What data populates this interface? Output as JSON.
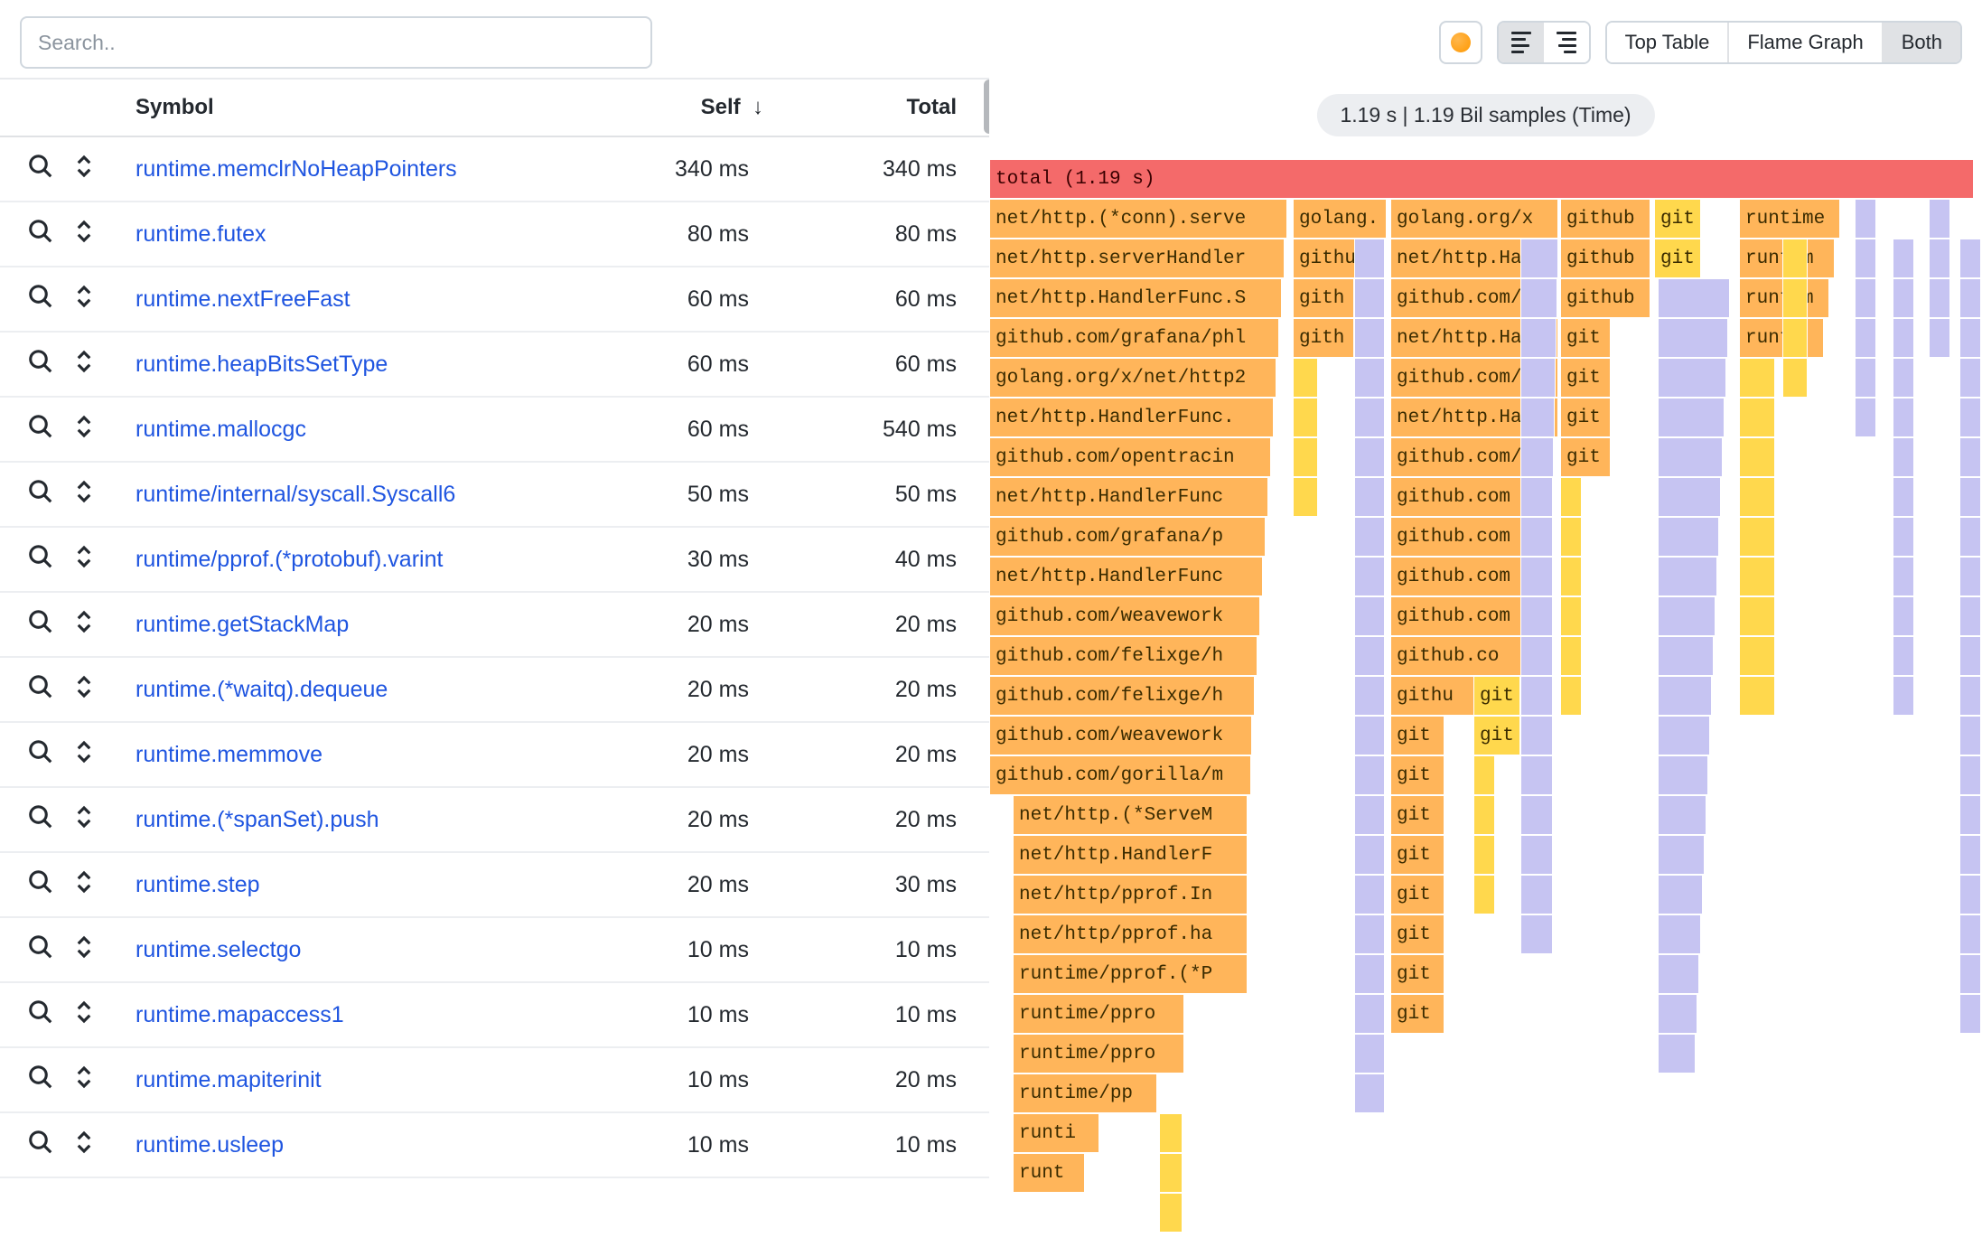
{
  "toolbar": {
    "search_placeholder": "Search..",
    "tabs": {
      "top_table": "Top Table",
      "flame_graph": "Flame Graph",
      "both": "Both"
    }
  },
  "summary_pill": "1.19 s | 1.19 Bil samples (Time)",
  "table": {
    "headers": {
      "symbol": "Symbol",
      "self": "Self",
      "self_sort": "↓",
      "total": "Total"
    },
    "rows": [
      {
        "symbol": "runtime.memclrNoHeapPointers",
        "self": "340 ms",
        "total": "340 ms"
      },
      {
        "symbol": "runtime.futex",
        "self": "80 ms",
        "total": "80 ms"
      },
      {
        "symbol": "runtime.nextFreeFast",
        "self": "60 ms",
        "total": "60 ms"
      },
      {
        "symbol": "runtime.heapBitsSetType",
        "self": "60 ms",
        "total": "60 ms"
      },
      {
        "symbol": "runtime.mallocgc",
        "self": "60 ms",
        "total": "540 ms"
      },
      {
        "symbol": "runtime/internal/syscall.Syscall6",
        "self": "50 ms",
        "total": "50 ms"
      },
      {
        "symbol": "runtime/pprof.(*protobuf).varint",
        "self": "30 ms",
        "total": "40 ms"
      },
      {
        "symbol": "runtime.getStackMap",
        "self": "20 ms",
        "total": "20 ms"
      },
      {
        "symbol": "runtime.(*waitq).dequeue",
        "self": "20 ms",
        "total": "20 ms"
      },
      {
        "symbol": "runtime.memmove",
        "self": "20 ms",
        "total": "20 ms"
      },
      {
        "symbol": "runtime.(*spanSet).push",
        "self": "20 ms",
        "total": "20 ms"
      },
      {
        "symbol": "runtime.step",
        "self": "20 ms",
        "total": "30 ms"
      },
      {
        "symbol": "runtime.selectgo",
        "self": "10 ms",
        "total": "10 ms"
      },
      {
        "symbol": "runtime.mapaccess1",
        "self": "10 ms",
        "total": "10 ms"
      },
      {
        "symbol": "runtime.mapiterinit",
        "self": "10 ms",
        "total": "20 ms"
      },
      {
        "symbol": "runtime.usleep",
        "self": "10 ms",
        "total": "10 ms"
      }
    ]
  },
  "flame": {
    "total_label": "total (1.19 s)",
    "col0": [
      "net/http.(*conn).serve",
      "net/http.serverHandler",
      "net/http.HandlerFunc.S",
      "github.com/grafana/phl",
      "golang.org/x/net/http2",
      "net/http.HandlerFunc.",
      "github.com/opentracin",
      "net/http.HandlerFunc",
      "github.com/grafana/p",
      "net/http.HandlerFunc",
      "github.com/weavework",
      "github.com/felixge/h",
      "github.com/felixge/h",
      "github.com/weavework",
      "github.com/gorilla/m"
    ],
    "col0b": [
      "net/http.(*ServeM",
      "net/http.HandlerF",
      "net/http/pprof.In",
      "net/http/pprof.ha",
      "runtime/pprof.(*P",
      "runtime/ppro",
      "runtime/ppro",
      "runtime/pp",
      "runti",
      "runt"
    ],
    "col1": [
      "golang.",
      "github",
      "gith",
      "gith"
    ],
    "col2": [
      "golang.org/x",
      "net/http.Han",
      "github.com/o",
      "net/http.Han",
      "github.com/g",
      "net/http.Ha",
      "github.com/",
      "github.com",
      "github.com",
      "github.com",
      "github.com",
      "github.co",
      "githu",
      "git",
      "git",
      "git",
      "git",
      "git",
      "git",
      "git",
      "git"
    ],
    "col2b": [
      "git",
      "git"
    ],
    "col3": [
      "github",
      "github",
      "github",
      "git",
      "git",
      "git",
      "git"
    ],
    "col4": [
      "git",
      "git"
    ],
    "col5": [
      "runtime",
      "runtim",
      "runtim",
      "runt"
    ]
  }
}
